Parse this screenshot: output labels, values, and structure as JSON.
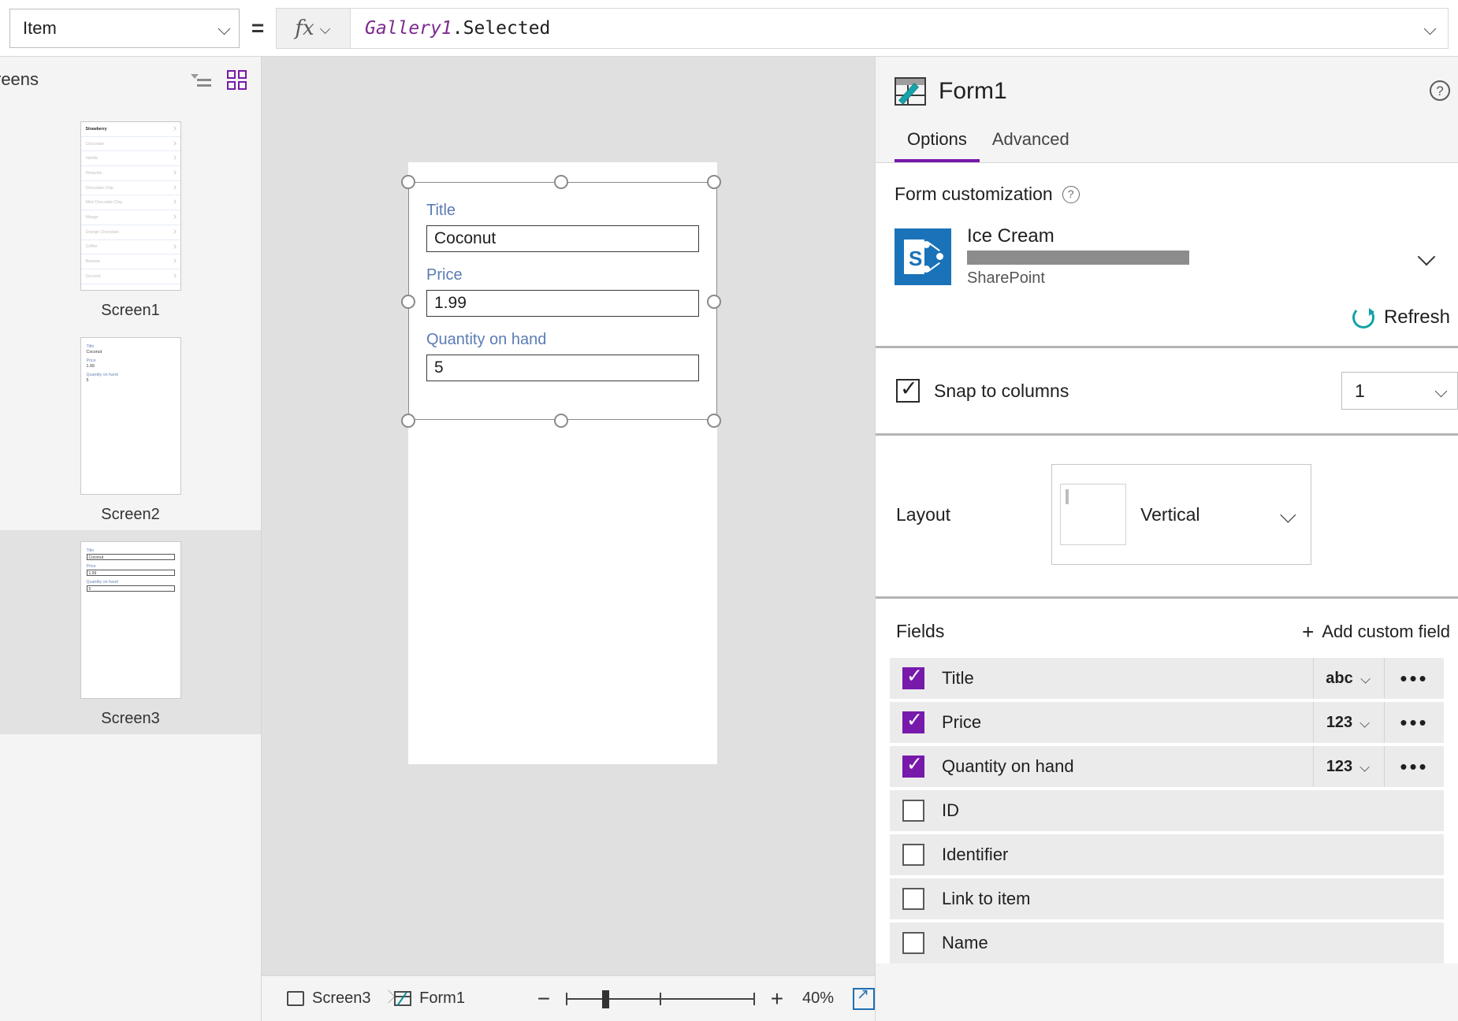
{
  "formula_bar": {
    "property": "Item",
    "equals": "=",
    "fx": "fx",
    "formula_ident": "Gallery1",
    "formula_rest": ".Selected"
  },
  "left_pane": {
    "title": "reens",
    "icons": {
      "tree": "tree-view-icon",
      "grid": "grid-view-icon"
    },
    "screens": [
      {
        "label": "Screen1",
        "type": "gallery",
        "items": [
          "Strawberry",
          "Chocolate",
          "Vanilla",
          "Pistachio",
          "Chocolate Chip",
          "Mint Chocolate Chip",
          "Mango",
          "Orange Chocolate",
          "Coffee",
          "Banana",
          "Coconut"
        ]
      },
      {
        "label": "Screen2",
        "type": "form_plain",
        "fields": [
          {
            "label": "Title",
            "value": "Coconut"
          },
          {
            "label": "Price",
            "value": "1.99"
          },
          {
            "label": "Quantity on hand",
            "value": "5"
          }
        ]
      },
      {
        "label": "Screen3",
        "type": "form_boxed",
        "selected": true,
        "fields": [
          {
            "label": "Title",
            "value": "Coconut"
          },
          {
            "label": "Price",
            "value": "1.99"
          },
          {
            "label": "Quantity on hand",
            "value": "5"
          }
        ]
      }
    ]
  },
  "canvas": {
    "form_fields": [
      {
        "label": "Title",
        "value": "Coconut"
      },
      {
        "label": "Price",
        "value": "1.99"
      },
      {
        "label": "Quantity on hand",
        "value": "5"
      }
    ]
  },
  "status_bar": {
    "breadcrumb": [
      {
        "label": "Screen3",
        "icon": "screen-icon"
      },
      {
        "label": "Form1",
        "icon": "edit-form-icon"
      }
    ],
    "zoom_out": "−",
    "zoom_in": "+",
    "zoom_level": "40%",
    "fullscreen_icon": "expand-icon"
  },
  "right_pane": {
    "title": "Form1",
    "header_icon": "edit-form-icon",
    "help_icon": "help-icon",
    "tabs": [
      {
        "label": "Options",
        "active": true
      },
      {
        "label": "Advanced",
        "active": false
      }
    ],
    "form_customization": {
      "title": "Form customization",
      "help_icon": "help-icon",
      "data_source": {
        "name": "Ice Cream",
        "url_redacted": "",
        "type": "SharePoint",
        "icon": "sharepoint-icon",
        "chevron": "chevron-down-icon"
      },
      "refresh_label": "Refresh",
      "refresh_icon": "refresh-icon"
    },
    "snap_to_columns": {
      "label": "Snap to columns",
      "checked": true,
      "columns_value": "1"
    },
    "layout": {
      "label": "Layout",
      "value": "Vertical"
    },
    "fields": {
      "title": "Fields",
      "add_label": "Add custom field",
      "add_icon": "plus-icon",
      "rows": [
        {
          "name": "Title",
          "checked": true,
          "type": "abc",
          "more": "•••"
        },
        {
          "name": "Price",
          "checked": true,
          "type": "123",
          "more": "•••"
        },
        {
          "name": "Quantity on hand",
          "checked": true,
          "type": "123",
          "more": "•••"
        },
        {
          "name": "ID",
          "checked": false,
          "type": "",
          "more": ""
        },
        {
          "name": "Identifier",
          "checked": false,
          "type": "",
          "more": ""
        },
        {
          "name": "Link to item",
          "checked": false,
          "type": "",
          "more": ""
        },
        {
          "name": "Name",
          "checked": false,
          "type": "",
          "more": ""
        }
      ]
    }
  },
  "colors": {
    "accent": "#7719aa",
    "sharepoint": "#1a72b8",
    "teal": "#12a3a8",
    "field_label": "#5b7bb5"
  }
}
